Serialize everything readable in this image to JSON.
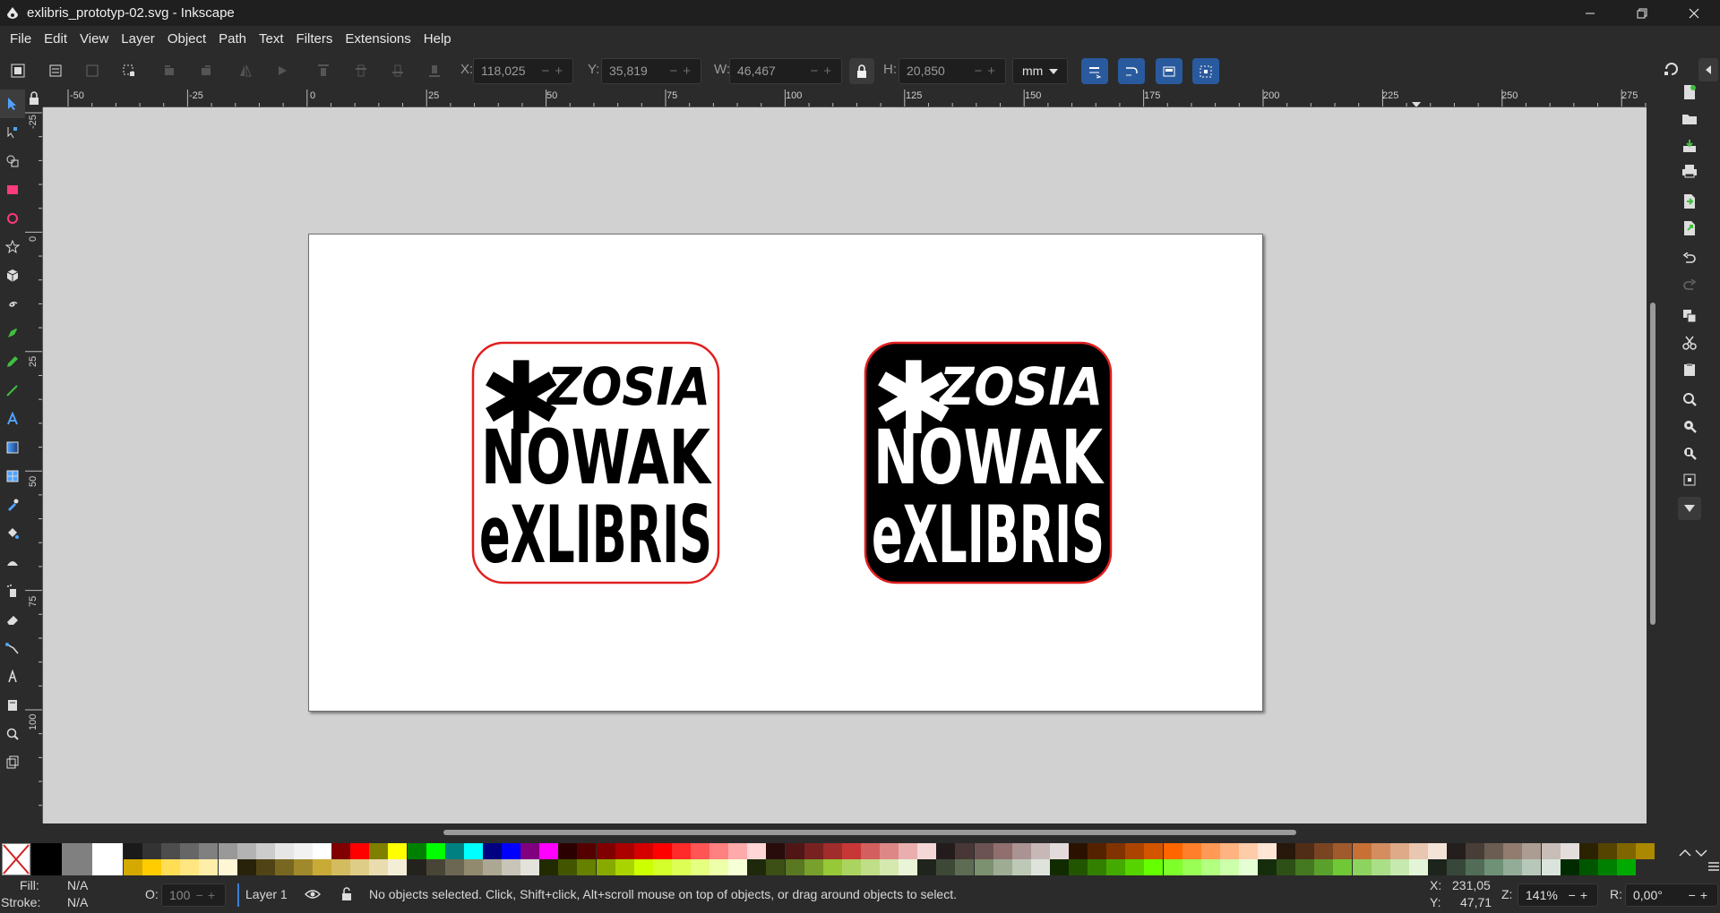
{
  "window": {
    "title": "exlibris_prototyp-02.svg - Inkscape",
    "controls": [
      "minimize",
      "restore",
      "close"
    ]
  },
  "menu": [
    "File",
    "Edit",
    "View",
    "Layer",
    "Object",
    "Path",
    "Text",
    "Filters",
    "Extensions",
    "Help"
  ],
  "tool_controls": {
    "x_label": "X:",
    "x_value": "118,025",
    "y_label": "Y:",
    "y_value": "35,819",
    "w_label": "W:",
    "w_value": "46,467",
    "h_label": "H:",
    "h_value": "20,850",
    "lock_icon": "lock-icon",
    "unit": "mm"
  },
  "ruler_top_labels": [
    "-50",
    "-25",
    "0",
    "25",
    "50",
    "75",
    "100",
    "125",
    "150",
    "175",
    "200",
    "225",
    "250",
    "275"
  ],
  "ruler_left_labels": [
    "-25",
    "0",
    "25",
    "50",
    "75",
    "100"
  ],
  "artwork": {
    "logo_left": {
      "line1": "ZOSIA",
      "line2": "NOWAK",
      "line3": "eXLIBRIS",
      "symbol": "✱",
      "fill": "#ffffff",
      "ink": "#000000",
      "outline": "#e02020"
    },
    "logo_right": {
      "line1": "ZOSIA",
      "line2": "NOWAK",
      "line3": "eXLIBRIS",
      "symbol": "✱",
      "fill": "#000000",
      "ink": "#ffffff",
      "outline": "#e02020"
    }
  },
  "palette": {
    "big": [
      "#000000",
      "#808080",
      "#ffffff"
    ],
    "row_top": [
      "#1a1a1a",
      "#333333",
      "#4d4d4d",
      "#666666",
      "#808080",
      "#999999",
      "#b3b3b3",
      "#cccccc",
      "#e6e6e6",
      "#f2f2f2",
      "#ffffff",
      "#800000",
      "#ff0000",
      "#808000",
      "#ffff00",
      "#008000",
      "#00ff00",
      "#008080",
      "#00ffff",
      "#000080",
      "#0000ff",
      "#800080",
      "#ff00ff",
      "#2b0000",
      "#550000",
      "#800000",
      "#aa0000",
      "#d40000",
      "#ff0000",
      "#ff2a2a",
      "#ff5555",
      "#ff8080",
      "#ffaaaa",
      "#ffd5d5",
      "#280b0b",
      "#501616",
      "#782121",
      "#a02c2c",
      "#c83737",
      "#d35f5f",
      "#de8787",
      "#e9afaf",
      "#f4d7d7",
      "#241c1c",
      "#483737",
      "#6c5353",
      "#916f6f",
      "#ac9393",
      "#c8b7b7",
      "#e3dbdb",
      "#2b1100",
      "#552200",
      "#803300",
      "#aa4400",
      "#d45500",
      "#ff6600",
      "#ff7f2a",
      "#ff9955",
      "#ffb380",
      "#ffccaa",
      "#ffe6d5",
      "#28170b",
      "#502d16",
      "#784421",
      "#a05a2c",
      "#c87137",
      "#d38d5f",
      "#deaa87",
      "#e9c6af",
      "#f4e3d7",
      "#241f1c",
      "#483e37",
      "#6c5d53",
      "#917c6f",
      "#ac9d93",
      "#c8beb7",
      "#e3dedb",
      "#2b2200",
      "#554400",
      "#806600",
      "#aa8800"
    ],
    "row_bottom": [
      "#d4aa00",
      "#ffcc00",
      "#ffdd55",
      "#ffe680",
      "#ffeeaa",
      "#fff6d5",
      "#28220b",
      "#504416",
      "#786721",
      "#a0892c",
      "#c8ab37",
      "#d3bc5f",
      "#decd87",
      "#e9ddaf",
      "#f4eed7",
      "#24221c",
      "#484537",
      "#6c6753",
      "#918a6f",
      "#aca793",
      "#c8c4b7",
      "#e3e2db",
      "#222b00",
      "#445500",
      "#668000",
      "#88aa00",
      "#aad400",
      "#ccff00",
      "#d4ff2a",
      "#ddff55",
      "#e5ff80",
      "#eeffaa",
      "#f6ffd5",
      "#1e280b",
      "#3c5016",
      "#5a7821",
      "#78a02c",
      "#96c837",
      "#abd35f",
      "#c0de87",
      "#d5e9af",
      "#eaf4d7",
      "#1f241c",
      "#3e4837",
      "#5d6c53",
      "#7c916f",
      "#9dac93",
      "#bec8b7",
      "#dee3db",
      "#112b00",
      "#225500",
      "#338000",
      "#44aa00",
      "#55d400",
      "#66ff00",
      "#7fff2a",
      "#99ff55",
      "#b3ff80",
      "#ccffaa",
      "#e5ffd5",
      "#162d0b",
      "#2d5016",
      "#447821",
      "#5aa02c",
      "#71c837",
      "#8dd35f",
      "#aade87",
      "#c6e9af",
      "#e3f4d7",
      "#1c241c",
      "#37483a",
      "#536c58",
      "#6f9176",
      "#93ac97",
      "#b7c8ba",
      "#dbe3dd",
      "#002b00",
      "#005500",
      "#008000",
      "#00aa00"
    ]
  },
  "status": {
    "fill_label": "Fill:",
    "fill_value": "N/A",
    "stroke_label": "Stroke:",
    "stroke_value": "N/A",
    "opacity_label": "O:",
    "opacity_value": "100",
    "layer": "Layer 1",
    "message": "No objects selected. Click, Shift+click, Alt+scroll mouse on top of objects, or drag around objects to select.",
    "x_label": "X:",
    "x_value": "231,05",
    "y_label": "Y:",
    "y_value": "47,71",
    "zoom_label": "Z:",
    "zoom_value": "141%",
    "rotate_label": "R:",
    "rotate_value": "0,00°"
  }
}
